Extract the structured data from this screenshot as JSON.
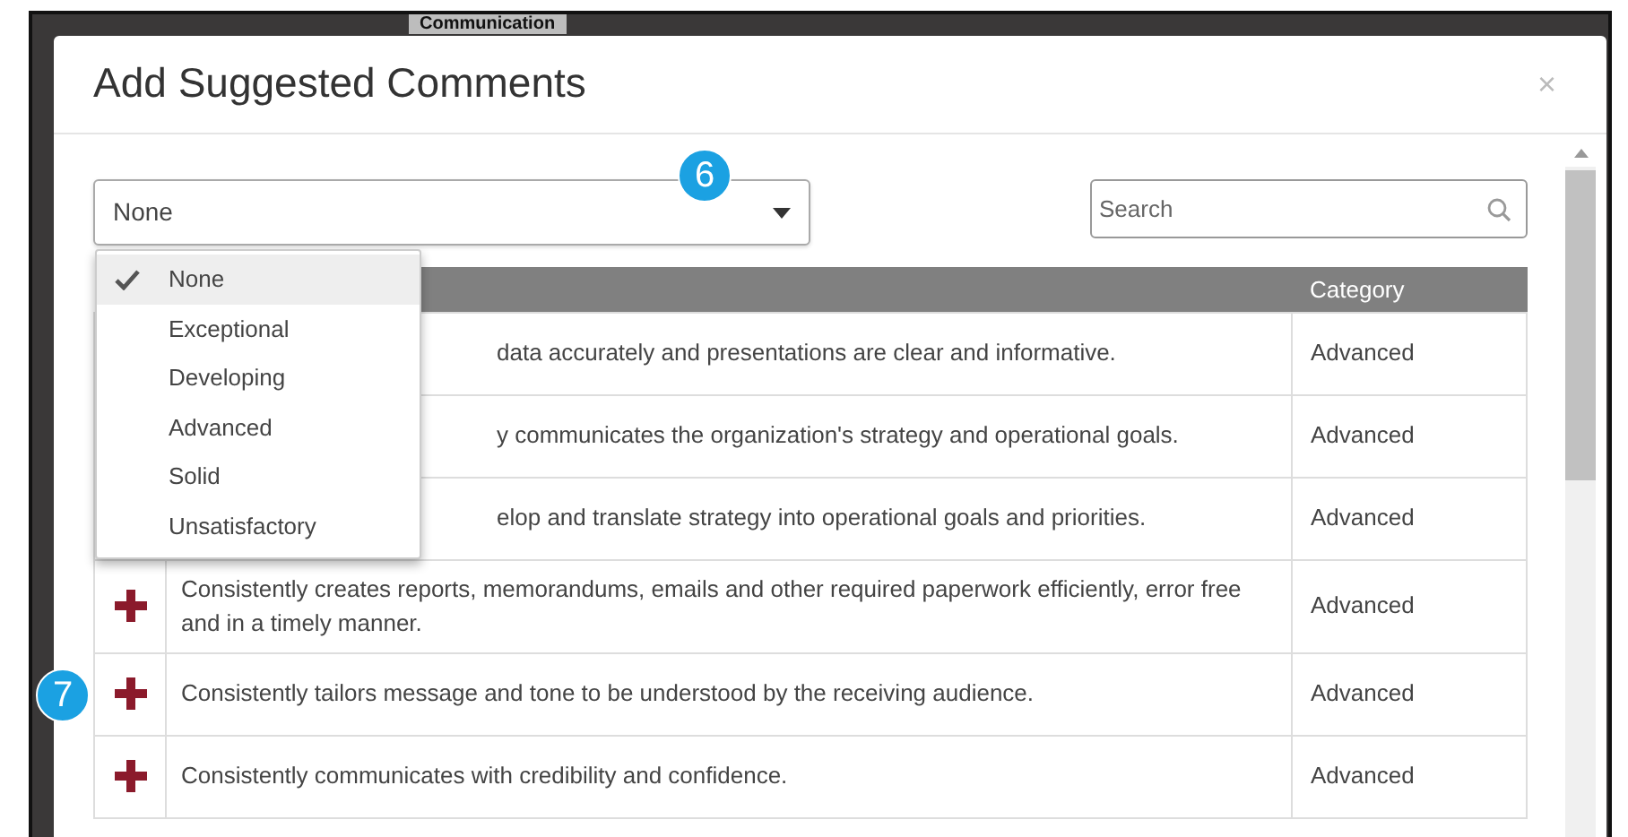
{
  "backdrop": {
    "heading": "Communication"
  },
  "dialog": {
    "title": "Add Suggested Comments",
    "close": "×"
  },
  "filter": {
    "value": "None",
    "callout": "6",
    "expanded": true,
    "options": [
      {
        "label": "None",
        "selected": true
      },
      {
        "label": "Exceptional",
        "selected": false
      },
      {
        "label": "Developing",
        "selected": false
      },
      {
        "label": "Advanced",
        "selected": false
      },
      {
        "label": "Solid",
        "selected": false
      },
      {
        "label": "Unsatisfactory",
        "selected": false
      }
    ]
  },
  "search": {
    "placeholder": "Search"
  },
  "table": {
    "category_heading": "Category",
    "rows": [
      {
        "comment": "data accurately and presentations are clear and informative.",
        "category": "Advanced",
        "add_icon": false
      },
      {
        "comment": "y communicates the organization's strategy and operational goals.",
        "category": "Advanced",
        "add_icon": false
      },
      {
        "comment": "elop and translate strategy into operational goals and priorities.",
        "category": "Advanced",
        "add_icon": false
      },
      {
        "comment": "Consistently creates reports, memorandums, emails and other required paperwork efficiently, error free and in a timely manner.",
        "category": "Advanced",
        "add_icon": true
      },
      {
        "comment": "Consistently tailors message and tone to be understood by the receiving audience.",
        "category": "Advanced",
        "add_icon": true,
        "callout": "7"
      },
      {
        "comment": "Consistently communicates with credibility and confidence.",
        "category": "Advanced",
        "add_icon": true
      }
    ]
  }
}
